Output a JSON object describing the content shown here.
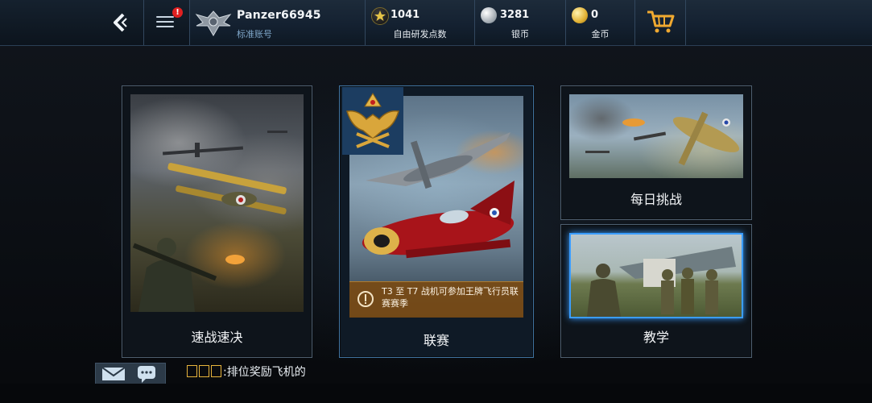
{
  "topbar": {
    "menu_badge": "!",
    "profile": {
      "username": "Panzer66945",
      "account_type": "标准账号"
    },
    "currencies": [
      {
        "icon": "star-xp-icon",
        "value": "1041",
        "label": "自由研发点数"
      },
      {
        "icon": "silver-coin-icon",
        "value": "3281",
        "label": "银币"
      },
      {
        "icon": "gold-coin-icon",
        "value": "0",
        "label": "金币"
      }
    ]
  },
  "modes": {
    "quick_battle": {
      "label": "速战速决"
    },
    "league": {
      "label": "联赛",
      "notice": "T3 至 T7 战机可参加王牌飞行员联赛赛季"
    },
    "daily_challenge": {
      "label": "每日挑战"
    },
    "tutorial": {
      "label": "教学"
    }
  },
  "bottom": {
    "message": ":排位奖励飞机的"
  },
  "colors": {
    "accent_blue": "#3a9dff",
    "gold": "#e2b234",
    "notice_bg": "#784a14"
  }
}
